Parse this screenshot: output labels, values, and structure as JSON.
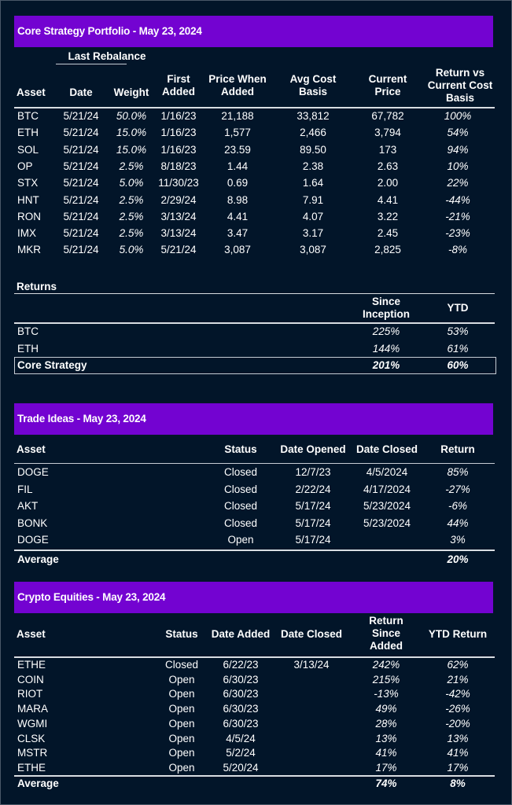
{
  "core_strategy": {
    "title": "Core Strategy Portfolio - May 23, 2024",
    "group_header": "Last Rebalance",
    "columns": {
      "asset": "Asset",
      "date": "Date",
      "weight": "Weight",
      "first_added": [
        "First",
        "Added"
      ],
      "price_when_added": [
        "Price When",
        "Added"
      ],
      "avg_cost_basis": [
        "Avg Cost",
        "Basis"
      ],
      "current_price": [
        "Current",
        "Price"
      ],
      "return_vs_cost": [
        "Return vs",
        "Current Cost",
        "Basis"
      ]
    },
    "rows": [
      {
        "asset": "BTC",
        "date": "5/21/24",
        "weight": "50.0%",
        "first_added": "1/16/23",
        "price_when_added": "21,188",
        "avg_cost_basis": "33,812",
        "current_price": "67,782",
        "return": "100%"
      },
      {
        "asset": "ETH",
        "date": "5/21/24",
        "weight": "15.0%",
        "first_added": "1/16/23",
        "price_when_added": "1,577",
        "avg_cost_basis": "2,466",
        "current_price": "3,794",
        "return": "54%"
      },
      {
        "asset": "SOL",
        "date": "5/21/24",
        "weight": "15.0%",
        "first_added": "1/16/23",
        "price_when_added": "23.59",
        "avg_cost_basis": "89.50",
        "current_price": "173",
        "return": "94%"
      },
      {
        "asset": "OP",
        "date": "5/21/24",
        "weight": "2.5%",
        "first_added": "8/18/23",
        "price_when_added": "1.44",
        "avg_cost_basis": "2.38",
        "current_price": "2.63",
        "return": "10%"
      },
      {
        "asset": "STX",
        "date": "5/21/24",
        "weight": "5.0%",
        "first_added": "11/30/23",
        "price_when_added": "0.69",
        "avg_cost_basis": "1.64",
        "current_price": "2.00",
        "return": "22%"
      },
      {
        "asset": "HNT",
        "date": "5/21/24",
        "weight": "2.5%",
        "first_added": "2/29/24",
        "price_when_added": "8.98",
        "avg_cost_basis": "7.91",
        "current_price": "4.41",
        "return": "-44%"
      },
      {
        "asset": "RON",
        "date": "5/21/24",
        "weight": "2.5%",
        "first_added": "3/13/24",
        "price_when_added": "4.41",
        "avg_cost_basis": "4.07",
        "current_price": "3.22",
        "return": "-21%"
      },
      {
        "asset": "IMX",
        "date": "5/21/24",
        "weight": "2.5%",
        "first_added": "3/13/24",
        "price_when_added": "3.47",
        "avg_cost_basis": "3.17",
        "current_price": "2.45",
        "return": "-23%"
      },
      {
        "asset": "MKR",
        "date": "5/21/24",
        "weight": "5.0%",
        "first_added": "5/21/24",
        "price_when_added": "3,087",
        "avg_cost_basis": "3,087",
        "current_price": "2,825",
        "return": "-8%"
      }
    ]
  },
  "returns": {
    "title": "Returns",
    "columns": {
      "since_inception": [
        "Since",
        "Inception"
      ],
      "ytd": "YTD"
    },
    "rows": [
      {
        "label": "BTC",
        "since_inception": "225%",
        "ytd": "53%"
      },
      {
        "label": "ETH",
        "since_inception": "144%",
        "ytd": "61%"
      },
      {
        "label": "Core Strategy",
        "since_inception": "201%",
        "ytd": "60%"
      }
    ]
  },
  "trade_ideas": {
    "title": "Trade Ideas - May 23, 2024",
    "columns": {
      "asset": "Asset",
      "status": "Status",
      "date_opened": "Date Opened",
      "date_closed": "Date Closed",
      "return": "Return"
    },
    "rows": [
      {
        "asset": "DOGE",
        "status": "Closed",
        "date_opened": "12/7/23",
        "date_closed": "4/5/2024",
        "return": "85%"
      },
      {
        "asset": "FIL",
        "status": "Closed",
        "date_opened": "2/22/24",
        "date_closed": "4/17/2024",
        "return": "-27%"
      },
      {
        "asset": "AKT",
        "status": "Closed",
        "date_opened": "5/17/24",
        "date_closed": "5/23/2024",
        "return": "-6%"
      },
      {
        "asset": "BONK",
        "status": "Closed",
        "date_opened": "5/17/24",
        "date_closed": "5/23/2024",
        "return": "44%"
      },
      {
        "asset": "DOGE",
        "status": "Open",
        "date_opened": "5/17/24",
        "date_closed": "",
        "return": "3%"
      }
    ],
    "average": {
      "label": "Average",
      "return": "20%"
    }
  },
  "crypto_equities": {
    "title": "Crypto Equities - May 23, 2024",
    "columns": {
      "asset": "Asset",
      "status": "Status",
      "date_added": "Date Added",
      "date_closed": "Date Closed",
      "return_since_added": [
        "Return",
        "Since",
        "Added"
      ],
      "ytd_return": "YTD Return"
    },
    "rows": [
      {
        "asset": "ETHE",
        "status": "Closed",
        "date_added": "6/22/23",
        "date_closed": "3/13/24",
        "return_since_added": "242%",
        "ytd_return": "62%"
      },
      {
        "asset": "COIN",
        "status": "Open",
        "date_added": "6/30/23",
        "date_closed": "",
        "return_since_added": "215%",
        "ytd_return": "21%"
      },
      {
        "asset": "RIOT",
        "status": "Open",
        "date_added": "6/30/23",
        "date_closed": "",
        "return_since_added": "-13%",
        "ytd_return": "-42%"
      },
      {
        "asset": "MARA",
        "status": "Open",
        "date_added": "6/30/23",
        "date_closed": "",
        "return_since_added": "49%",
        "ytd_return": "-26%"
      },
      {
        "asset": "WGMI",
        "status": "Open",
        "date_added": "6/30/23",
        "date_closed": "",
        "return_since_added": "28%",
        "ytd_return": "-20%"
      },
      {
        "asset": "CLSK",
        "status": "Open",
        "date_added": "4/5/24",
        "date_closed": "",
        "return_since_added": "13%",
        "ytd_return": "13%"
      },
      {
        "asset": "MSTR",
        "status": "Open",
        "date_added": "5/2/24",
        "date_closed": "",
        "return_since_added": "41%",
        "ytd_return": "41%"
      },
      {
        "asset": "ETHE",
        "status": "Open",
        "date_added": "5/20/24",
        "date_closed": "",
        "return_since_added": "17%",
        "ytd_return": "17%"
      }
    ],
    "average": {
      "label": "Average",
      "return_since_added": "74%",
      "ytd_return": "8%"
    }
  },
  "colors": {
    "background": "#011627",
    "header_band": "#7303d1",
    "text": "#ffffff"
  }
}
